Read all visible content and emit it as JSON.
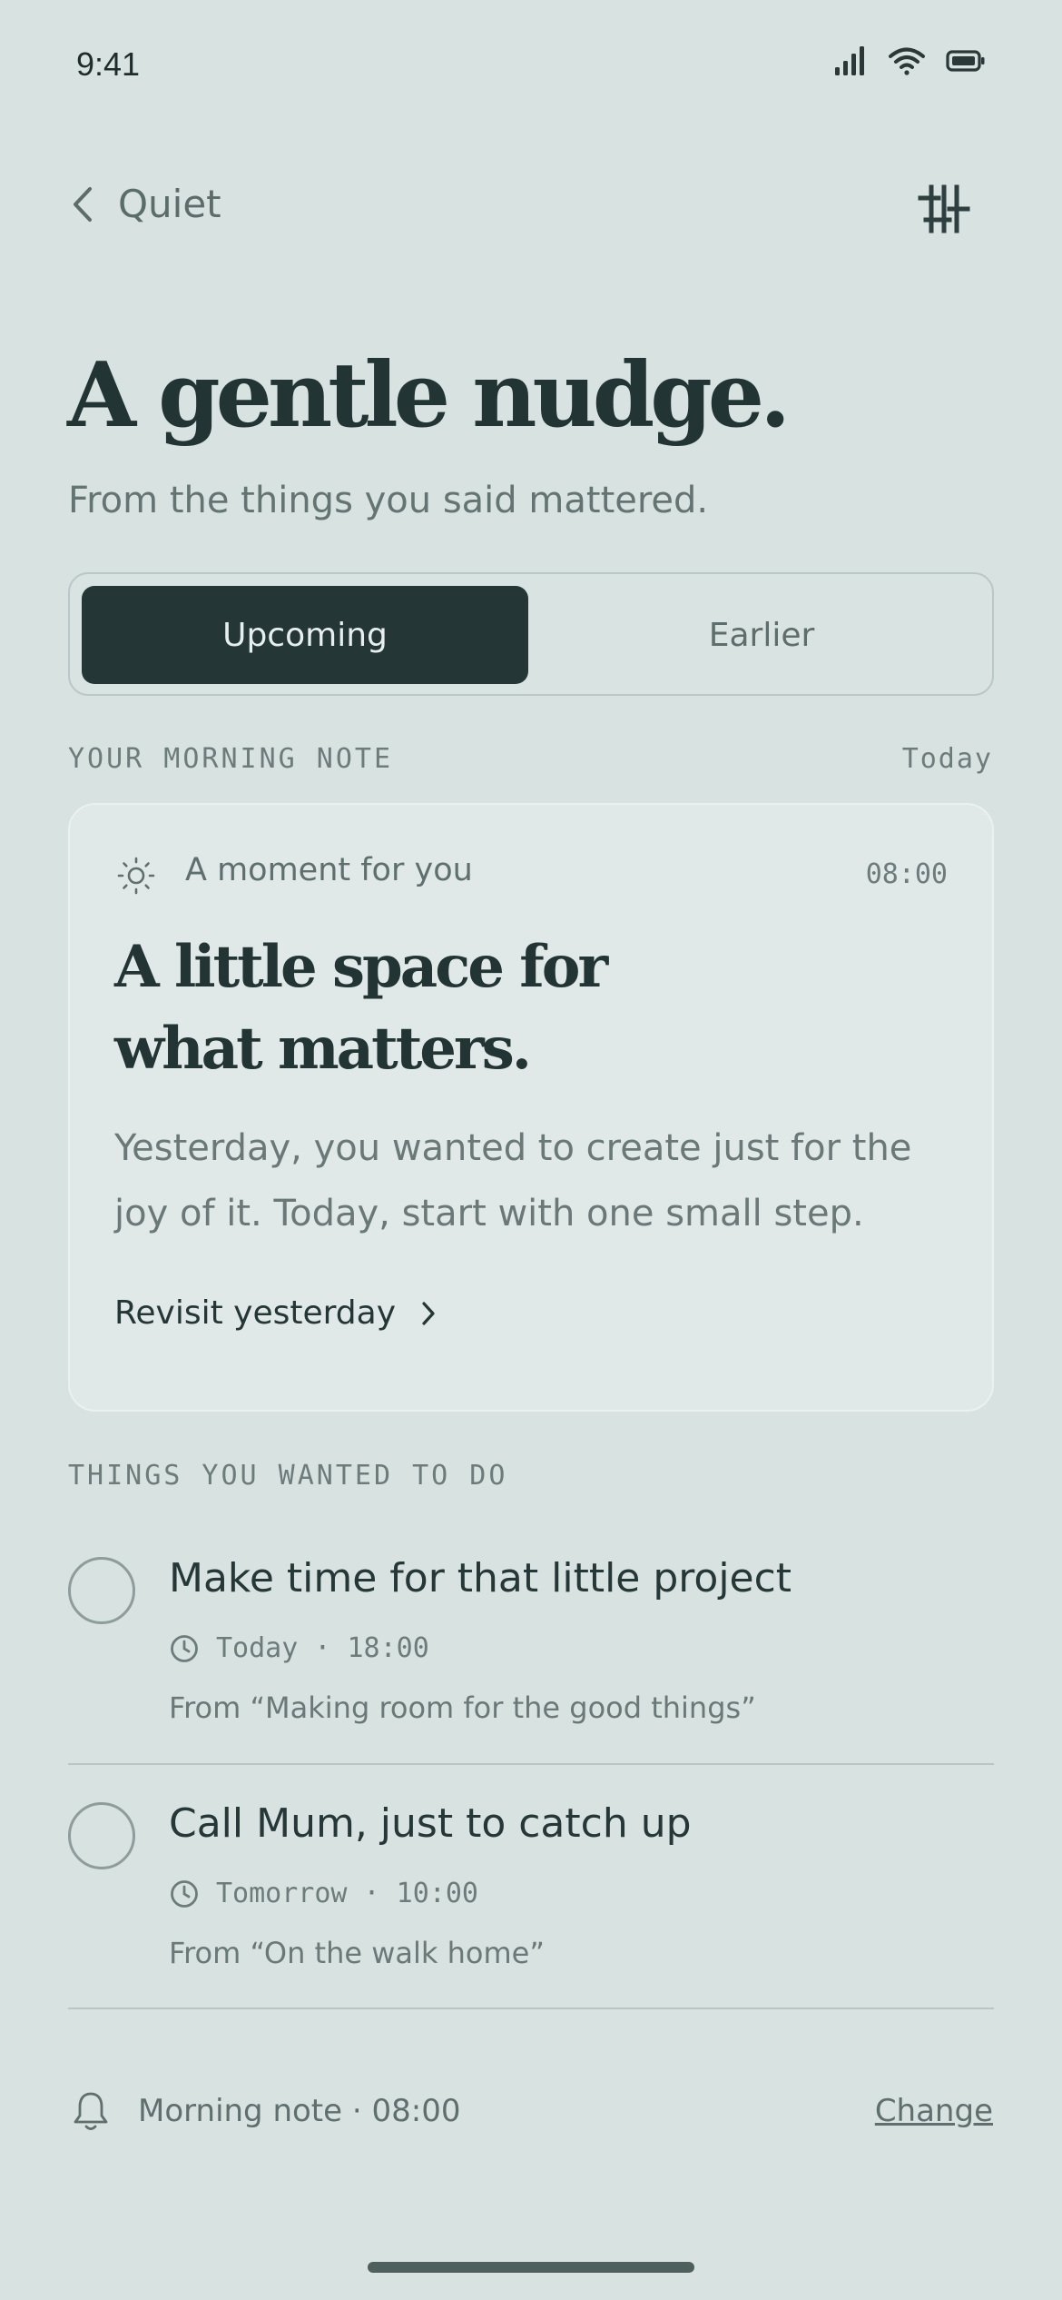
{
  "status_bar": {
    "time": "9:41"
  },
  "nav": {
    "back_label": "Quiet"
  },
  "header": {
    "title": "A gentle nudge.",
    "subtitle": "From the things you said mattered."
  },
  "segments": {
    "active": "Upcoming",
    "inactive": "Earlier"
  },
  "morning_note": {
    "section_label": "YOUR MORNING NOTE",
    "section_date": "Today",
    "kicker": "A moment for you",
    "time": "08:00",
    "title_line1": "A little space for",
    "title_line2": "what matters.",
    "body": "Yesterday, you wanted to create just for the joy of it. Today, start with one small step.",
    "link": "Revisit yesterday"
  },
  "tasks": {
    "section_label": "THINGS YOU WANTED TO DO",
    "items": [
      {
        "title": "Make time for that little project",
        "when": "Today · 18:00",
        "source": "From “Making room for the good things”"
      },
      {
        "title": "Call Mum, just to catch up",
        "when": "Tomorrow · 10:00",
        "source": "From “On the walk home”"
      }
    ]
  },
  "footer": {
    "note": "Morning note · 08:00",
    "change": "Change"
  },
  "colors": {
    "background": "#d7e2e1",
    "ink": "#253636",
    "muted": "#647473",
    "card": "#e0e9e8"
  }
}
